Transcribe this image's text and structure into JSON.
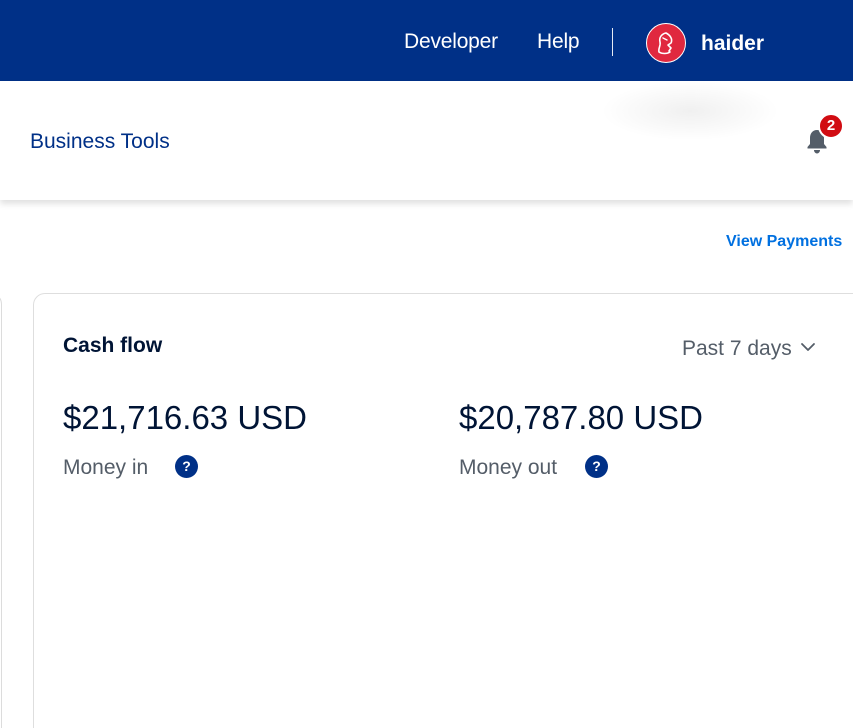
{
  "topbar": {
    "developer_label": "Developer",
    "help_label": "Help",
    "username": "haider",
    "background_color": "#003087"
  },
  "subheader": {
    "business_tools_label": "Business Tools",
    "notification_count": "2",
    "notification_icon": "bell-icon"
  },
  "payments": {
    "view_payments_label": "View Payments"
  },
  "cash_flow": {
    "title": "Cash flow",
    "period": "Past 7 days",
    "period_icon": "chevron-down-icon",
    "money_in_amount": "$21,716.63 USD",
    "money_in_label": "Money in",
    "money_out_amount": "$20,787.80 USD",
    "money_out_label": "Money out",
    "help_glyph": "?"
  },
  "colors": {
    "brand_navy": "#003087",
    "link_blue": "#0070e0",
    "badge_red": "#d10c12",
    "avatar_red": "#e0283f",
    "text_dark": "#001435",
    "text_muted": "#545d68"
  }
}
